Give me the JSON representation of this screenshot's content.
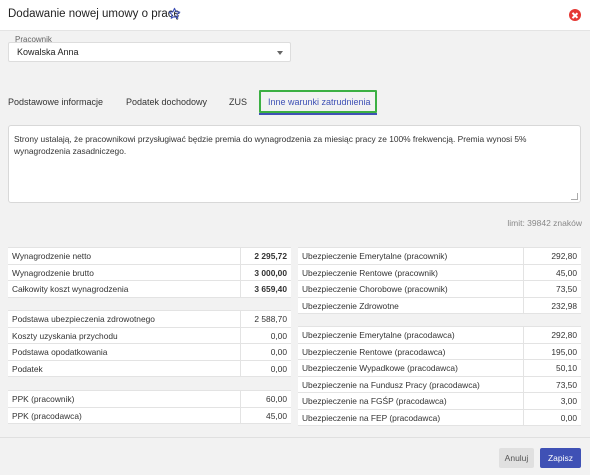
{
  "dialog": {
    "title": "Dodawanie nowej umowy o pracę",
    "favorite_icon": "star-outline-icon",
    "close_icon": "close-circle-icon"
  },
  "employee": {
    "label": "Pracownik",
    "value": "Kowalska Anna"
  },
  "tabs": [
    {
      "label": "Podstawowe informacje",
      "active": false
    },
    {
      "label": "Podatek dochodowy",
      "active": false
    },
    {
      "label": "ZUS",
      "active": false
    },
    {
      "label": "Inne warunki zatrudnienia",
      "active": true
    }
  ],
  "conditions_text": "Strony ustalają, że pracownikowi przysługiwać będzie premia do wynagrodzenia za miesiąc pracy ze 100% frekwencją. Premia wynosi 5% wynagrodzenia zasadniczego.",
  "limit_text": "limit: 39842 znaków",
  "left_summary": [
    {
      "label": "Wynagrodzenie netto",
      "value": "2 295,72"
    },
    {
      "label": "Wynagrodzenie brutto",
      "value": "3 000,00"
    },
    {
      "label": "Całkowity koszt wynagrodzenia",
      "value": "3 659,40"
    }
  ],
  "left_tax": [
    {
      "label": "Podstawa ubezpieczenia zdrowotnego",
      "value": "2 588,70"
    },
    {
      "label": "Koszty uzyskania przychodu",
      "value": "0,00"
    },
    {
      "label": "Podstawa opodatkowania",
      "value": "0,00"
    },
    {
      "label": "Podatek",
      "value": "0,00"
    }
  ],
  "left_ppk": [
    {
      "label": "PPK (pracownik)",
      "value": "60,00"
    },
    {
      "label": "PPK (pracodawca)",
      "value": "45,00"
    }
  ],
  "right_employee": [
    {
      "label": "Ubezpieczenie Emerytalne (pracownik)",
      "value": "292,80"
    },
    {
      "label": "Ubezpieczenie Rentowe (pracownik)",
      "value": "45,00"
    },
    {
      "label": "Ubezpieczenie Chorobowe (pracownik)",
      "value": "73,50"
    },
    {
      "label": "Ubezpieczenie Zdrowotne",
      "value": "232,98"
    }
  ],
  "right_employer": [
    {
      "label": "Ubezpieczenie Emerytalne (pracodawca)",
      "value": "292,80"
    },
    {
      "label": "Ubezpieczenie Rentowe (pracodawca)",
      "value": "195,00"
    },
    {
      "label": "Ubezpieczenie Wypadkowe (pracodawca)",
      "value": "50,10"
    },
    {
      "label": "Ubezpieczenie na Fundusz Pracy (pracodawca)",
      "value": "73,50"
    },
    {
      "label": "Ubezpieczenie na FGŚP (pracodawca)",
      "value": "3,00"
    },
    {
      "label": "Ubezpieczenie na FEP (pracodawca)",
      "value": "0,00"
    }
  ],
  "buttons": {
    "cancel": "Anuluj",
    "save": "Zapisz"
  },
  "colors": {
    "accent": "#3f51b5",
    "highlight_border": "#3cb043",
    "close": "#e53935"
  }
}
